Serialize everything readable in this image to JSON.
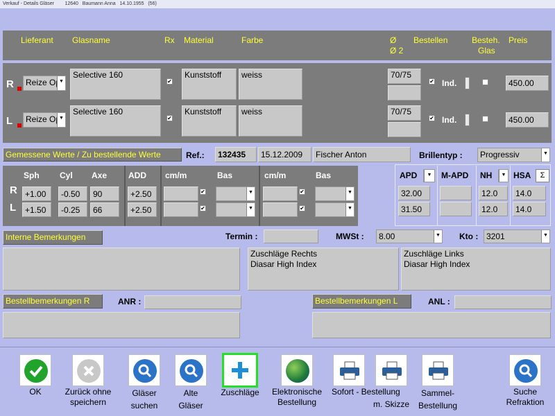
{
  "window": {
    "title": "Verkauf - Details Gläser        12640   Baumann Anna   14.10.1955   (56)"
  },
  "header": {
    "lieferant": "Lieferant",
    "glasname": "Glasname",
    "rx": "Rx",
    "material": "Material",
    "farbe": "Farbe",
    "o1": "Ø",
    "o2": "Ø 2",
    "bestellen": "Bestellen",
    "besteh1": "Besteh.",
    "besteh2": "Glas",
    "preis": "Preis"
  },
  "right": {
    "side": "R",
    "lieferant": "Reize Op",
    "glasname": "Selective 160",
    "rx_checked": "✔",
    "material": "Kunststoff",
    "farbe": "weiss",
    "diameter": "70/75",
    "diameter2": "",
    "bestellen_checked": "✔",
    "ind": "Ind.",
    "preis": "450.00"
  },
  "left": {
    "side": "L",
    "lieferant": "Reize Op",
    "glasname": "Selective 160",
    "rx_checked": "✔",
    "material": "Kunststoff",
    "farbe": "weiss",
    "diameter": "70/75",
    "diameter2": "",
    "bestellen_checked": "✔",
    "ind": "Ind.",
    "preis": "450.00"
  },
  "measured": {
    "title": "Gemessene Werte / Zu bestellende Werte",
    "ref_label": "Ref.:",
    "ref": "132435",
    "date": "15.12.2009",
    "person": "Fischer Anton",
    "brillentyp_label": "Brillentyp :",
    "brillentyp": "Progressiv"
  },
  "rx": {
    "headers": [
      "Sph",
      "Cyl",
      "Axe",
      "ADD",
      "cm/m",
      "Bas",
      "cm/m",
      "Bas"
    ],
    "rows": [
      {
        "side": "R",
        "sph": "+1.00",
        "cyl": "-0.50",
        "axe": "90",
        "add": "+2.50"
      },
      {
        "side": "L",
        "sph": "+1.50",
        "cyl": "-0.25",
        "axe": "66",
        "add": "+2.50"
      }
    ],
    "checked": "✔"
  },
  "pd": {
    "headers": {
      "apd": "APD",
      "mapd": "M-APD",
      "nh": "NH",
      "hsa": "HSA",
      "sigma": "Σ"
    },
    "rows": [
      {
        "apd": "32.00",
        "mapd": "",
        "nh": "12.0",
        "hsa": "14.0"
      },
      {
        "apd": "31.50",
        "mapd": "",
        "nh": "12.0",
        "hsa": "14.0"
      }
    ]
  },
  "internal": {
    "label": "Interne Bemerkungen",
    "termin_label": "Termin :",
    "termin": "",
    "mwst_label": "MWSt :",
    "mwst": "8.00",
    "kto_label": "Kto :",
    "kto": "3201",
    "notes": "",
    "zuschlaege_rechts": "Zuschläge Rechts\nDiasar High Index",
    "zuschlaege_links": "Zuschläge Links\nDiasar High Index"
  },
  "order_notes": {
    "r_label": "Bestellbemerkungen R",
    "anr_label": "ANR :",
    "anr": "",
    "l_label": "Bestellbemerkungen L",
    "anl_label": "ANL :",
    "anl": "",
    "r_text": "",
    "l_text": ""
  },
  "toolbar": {
    "ok": "OK",
    "zurueck": "Zurück ohne\nspeichern",
    "glaeser_suchen": "Gläser\nsuchen",
    "alte_glaeser": "Alte\nGläser",
    "zuschlaege": "Zuschläge",
    "elektronische": "Elektronische\nBestellung",
    "sofort": "Sofort - Bestellung",
    "mskizze": "m. Skizze",
    "sammel": "Sammel-\nBestellung",
    "suche_refraktion": "Suche\nRefraktion"
  },
  "colors": {
    "background": "#b7bbeb",
    "panel": "#7c7c7c",
    "header_text": "#ffff38",
    "ok_green": "#22a32c",
    "highlight_border": "#22e022",
    "plus_blue": "#1e8fd6"
  },
  "icons": {
    "ok": "check-icon",
    "cancel": "x-icon",
    "search": "magnifier-icon",
    "plus": "plus-icon",
    "globe": "globe-icon",
    "printer": "printer-icon"
  }
}
